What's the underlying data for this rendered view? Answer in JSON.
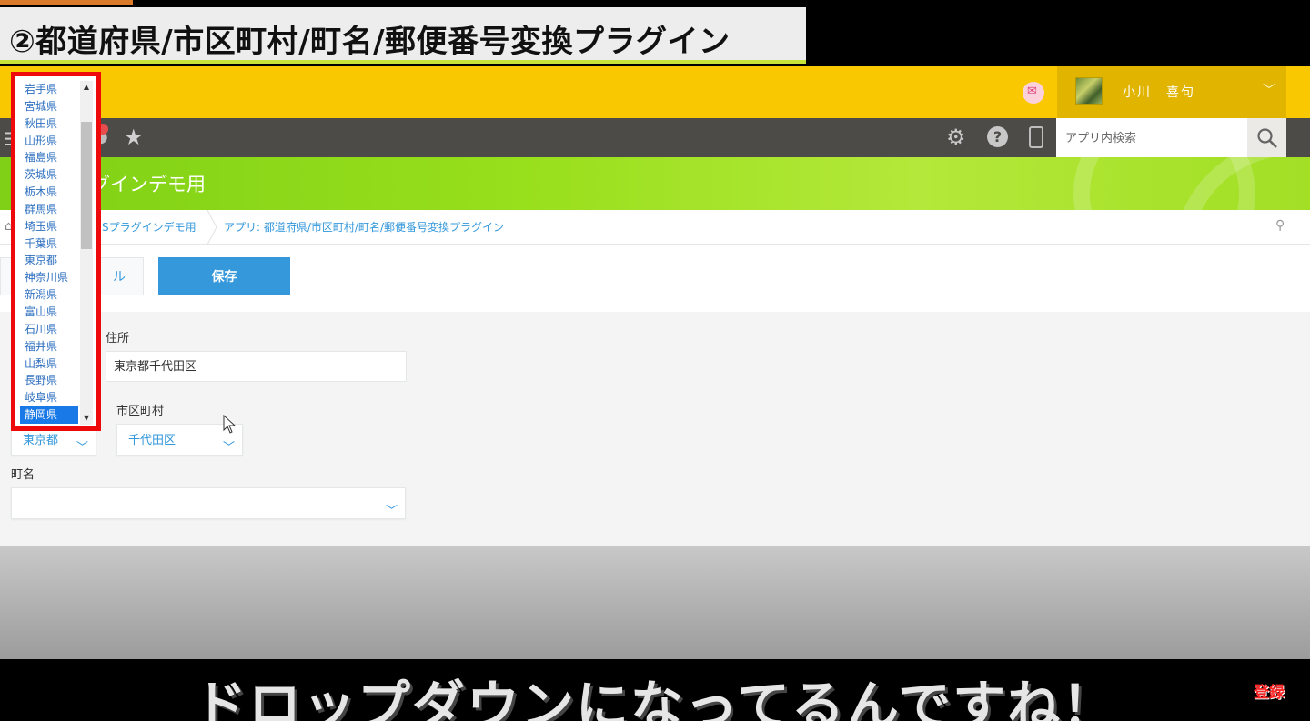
{
  "video": {
    "title": "②都道府県/市区町村/町名/郵便番号変換プラグイン",
    "subtitle": "ドロップダウンになってるんですね！",
    "subscribe_badge": "登録"
  },
  "header": {
    "user_name": "小川　喜句",
    "search_placeholder": "アプリ内検索"
  },
  "app": {
    "title": "グインデモ用",
    "breadcrumb": [
      "Sプラグインデモ用",
      "アプリ: 都道府県/市区町村/町名/郵便番号変換プラグイン"
    ]
  },
  "toolbar": {
    "cancel_label": "ル",
    "save_label": "保存"
  },
  "form": {
    "address_label": "住所",
    "address_value": "東京都千代田区",
    "prefecture_value": "東京都",
    "city_label": "市区町村",
    "city_value": "千代田区",
    "town_label": "町名",
    "town_value": ""
  },
  "dropdown": {
    "items": [
      "岩手県",
      "宮城県",
      "秋田県",
      "山形県",
      "福島県",
      "茨城県",
      "栃木県",
      "群馬県",
      "埼玉県",
      "千葉県",
      "東京都",
      "神奈川県",
      "新潟県",
      "富山県",
      "石川県",
      "福井県",
      "山梨県",
      "長野県",
      "岐阜県",
      "静岡県"
    ],
    "selected": "静岡県"
  },
  "colors": {
    "accent_yellow": "#f9c800",
    "header_dark": "#4d4b48",
    "app_green": "#8fd81a",
    "primary_blue": "#3498db",
    "highlight_red": "#ee0a0a"
  },
  "icons": [
    "menu-icon",
    "person-icon",
    "star-icon",
    "gear-icon",
    "help-icon",
    "mobile-icon",
    "search-icon",
    "home-icon",
    "pin-icon",
    "mail-icon",
    "chevron-down-icon",
    "cursor-icon"
  ]
}
